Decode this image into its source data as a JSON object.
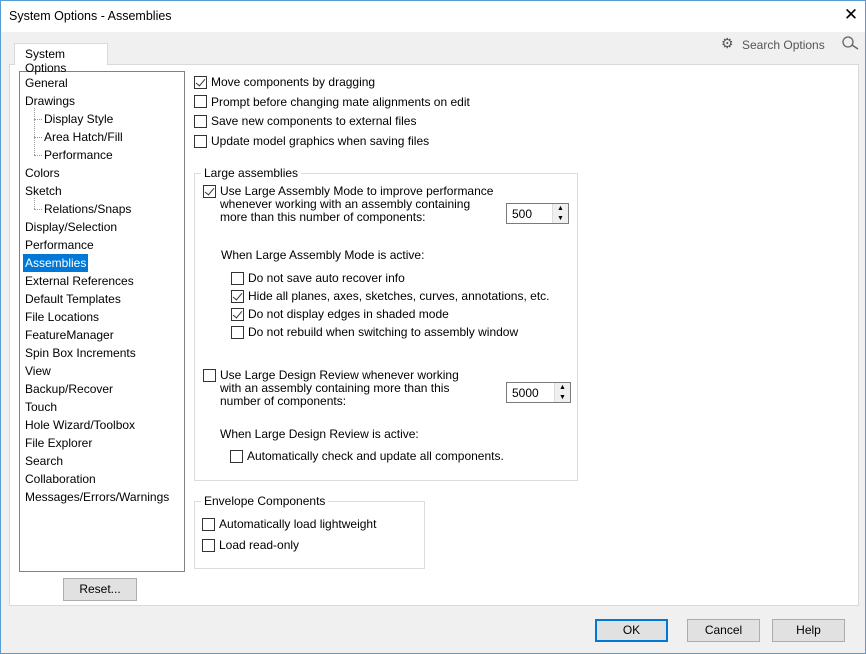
{
  "window": {
    "title": "System Options - Assemblies",
    "close": "✕"
  },
  "tab": "System Options",
  "search": {
    "placeholder": "Search Options"
  },
  "sidebar": {
    "items": [
      {
        "label": "General",
        "level": 0
      },
      {
        "label": "Drawings",
        "level": 0
      },
      {
        "label": "Display Style",
        "level": 1
      },
      {
        "label": "Area Hatch/Fill",
        "level": 1
      },
      {
        "label": "Performance",
        "level": 1
      },
      {
        "label": "Colors",
        "level": 0
      },
      {
        "label": "Sketch",
        "level": 0
      },
      {
        "label": "Relations/Snaps",
        "level": 1
      },
      {
        "label": "Display/Selection",
        "level": 0
      },
      {
        "label": "Performance",
        "level": 0
      },
      {
        "label": "Assemblies",
        "level": 0,
        "selected": true
      },
      {
        "label": "External References",
        "level": 0
      },
      {
        "label": "Default Templates",
        "level": 0
      },
      {
        "label": "File Locations",
        "level": 0
      },
      {
        "label": "FeatureManager",
        "level": 0
      },
      {
        "label": "Spin Box Increments",
        "level": 0
      },
      {
        "label": "View",
        "level": 0
      },
      {
        "label": "Backup/Recover",
        "level": 0
      },
      {
        "label": "Touch",
        "level": 0
      },
      {
        "label": "Hole Wizard/Toolbox",
        "level": 0
      },
      {
        "label": "File Explorer",
        "level": 0
      },
      {
        "label": "Search",
        "level": 0
      },
      {
        "label": "Collaboration",
        "level": 0
      },
      {
        "label": "Messages/Errors/Warnings",
        "level": 0
      }
    ],
    "reset": "Reset..."
  },
  "top_options": [
    {
      "label": "Move components by dragging",
      "checked": true
    },
    {
      "label": "Prompt before changing mate alignments on edit",
      "checked": false
    },
    {
      "label": "Save new components to external files",
      "checked": false
    },
    {
      "label": "Update model graphics when saving files",
      "checked": false
    }
  ],
  "large_assemblies": {
    "title": "Large assemblies",
    "lam": {
      "lines": [
        "Use Large Assembly Mode to improve performance",
        "whenever working with an assembly containing",
        "more than this number of components:"
      ],
      "checked": true,
      "value": "500"
    },
    "lam_active_label": "When Large Assembly Mode is active:",
    "lam_options": [
      {
        "label": "Do not save auto recover info",
        "checked": false
      },
      {
        "label": "Hide all planes, axes, sketches, curves, annotations, etc.",
        "checked": true
      },
      {
        "label": "Do not display edges in shaded mode",
        "checked": true
      },
      {
        "label": "Do not rebuild when switching to assembly window",
        "checked": false
      }
    ],
    "ldr": {
      "lines": [
        "Use Large Design Review whenever working",
        "with an assembly containing more than this",
        "number of components:"
      ],
      "checked": false,
      "value": "5000"
    },
    "ldr_active_label": "When Large Design Review is active:",
    "ldr_options": [
      {
        "label": "Automatically check and update all components.",
        "checked": false
      }
    ]
  },
  "envelope": {
    "title": "Envelope Components",
    "options": [
      {
        "label": "Automatically load lightweight",
        "checked": false
      },
      {
        "label": "Load read-only",
        "checked": false
      }
    ]
  },
  "buttons": {
    "ok": "OK",
    "cancel": "Cancel",
    "help": "Help"
  }
}
